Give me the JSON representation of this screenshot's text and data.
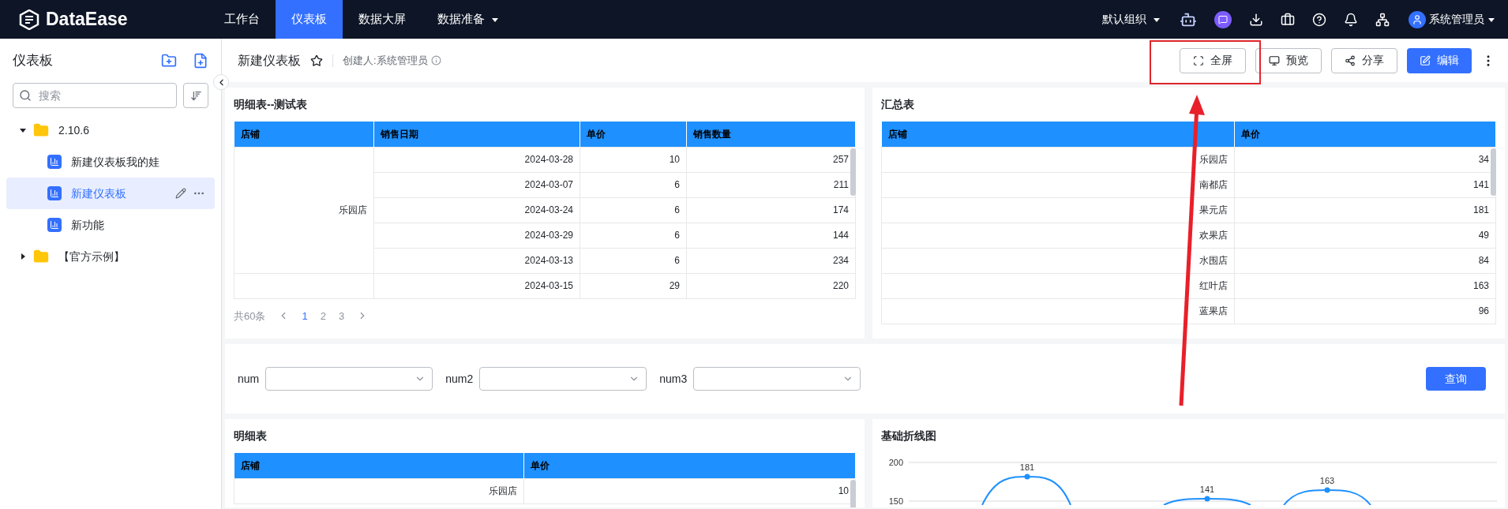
{
  "topbar": {
    "logo": "DataEase",
    "nav": [
      {
        "label": "工作台",
        "selected": false,
        "dropdown": false
      },
      {
        "label": "仪表板",
        "selected": true,
        "dropdown": false
      },
      {
        "label": "数据大屏",
        "selected": false,
        "dropdown": false
      },
      {
        "label": "数据准备",
        "selected": false,
        "dropdown": true
      }
    ],
    "org": "默认组织",
    "user": "系统管理员"
  },
  "sidebar": {
    "title": "仪表板",
    "search": {
      "placeholder": "搜索"
    },
    "tree": [
      {
        "label": "2.10.6",
        "kind": "folder",
        "expanded": true,
        "children": [
          {
            "label": "新建仪表板我的娃",
            "kind": "dashboard",
            "selected": false
          },
          {
            "label": "新建仪表板",
            "kind": "dashboard",
            "selected": true
          },
          {
            "label": "新功能",
            "kind": "dashboard",
            "selected": false
          }
        ]
      },
      {
        "label": "【官方示例】",
        "kind": "folder",
        "expanded": false
      }
    ]
  },
  "header": {
    "title": "新建仪表板",
    "creator": "创建人:系统管理员",
    "buttons": [
      {
        "label": "全屏",
        "kind": "fullscreen",
        "primary": false
      },
      {
        "label": "预览",
        "kind": "preview",
        "primary": false
      },
      {
        "label": "分享",
        "kind": "share",
        "primary": false
      },
      {
        "label": "编辑",
        "kind": "edit",
        "primary": true
      }
    ]
  },
  "detail_table": {
    "title": "明细表--测试表",
    "columns": [
      "店铺",
      "销售日期",
      "单价",
      "销售数量"
    ],
    "groups": [
      {
        "store": "乐园店",
        "rows": [
          [
            "2024-03-28",
            "10",
            "257"
          ],
          [
            "2024-03-07",
            "6",
            "211"
          ],
          [
            "2024-03-24",
            "6",
            "174"
          ],
          [
            "2024-03-29",
            "6",
            "144"
          ],
          [
            "2024-03-13",
            "6",
            "234"
          ]
        ]
      },
      {
        "rows": [
          [
            "2024-03-15",
            "29",
            "220"
          ]
        ]
      }
    ],
    "pagination": {
      "total": "共60条",
      "pages": [
        {
          "label": "1",
          "selected": true
        },
        {
          "label": "2",
          "selected": false
        },
        {
          "label": "3",
          "selected": false
        }
      ]
    }
  },
  "summary_table": {
    "title": "汇总表",
    "columns": [
      "店铺",
      "单价"
    ],
    "rows": [
      [
        "乐园店",
        "34"
      ],
      [
        "南都店",
        "141"
      ],
      [
        "果元店",
        "181"
      ],
      [
        "欢果店",
        "49"
      ],
      [
        "水围店",
        "84"
      ],
      [
        "红叶店",
        "163"
      ],
      [
        "蓝果店",
        "96"
      ]
    ]
  },
  "filters": {
    "fields": [
      {
        "label": "num"
      },
      {
        "label": "num2"
      },
      {
        "label": "num3"
      }
    ],
    "query_button": "查询"
  },
  "bottom_table": {
    "title": "明细表",
    "columns": [
      "店铺",
      "单价"
    ],
    "rows": [
      [
        "乐园店",
        "10"
      ]
    ]
  },
  "line_chart": {
    "title": "基础折线图",
    "y_axis_labels": [
      "200",
      "150"
    ],
    "data_labels": [
      "181",
      "141",
      "163"
    ]
  }
}
